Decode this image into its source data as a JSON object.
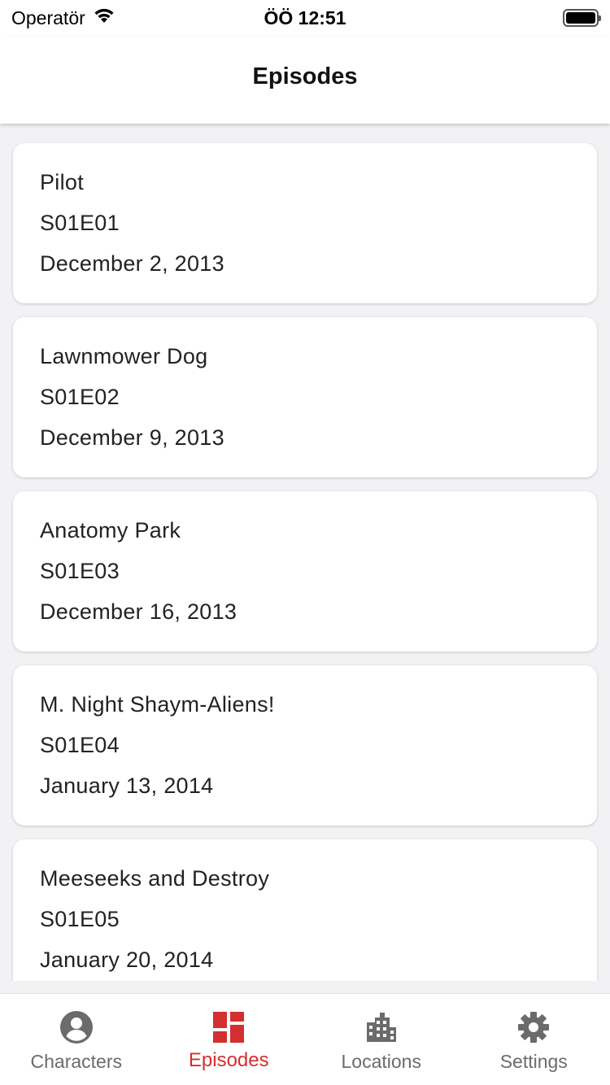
{
  "status_bar": {
    "carrier": "Operatör",
    "time": "ÖÖ 12:51"
  },
  "app_bar": {
    "title": "Episodes"
  },
  "episodes": [
    {
      "name": "Pilot",
      "code": "S01E01",
      "air_date": "December 2, 2013"
    },
    {
      "name": "Lawnmower Dog",
      "code": "S01E02",
      "air_date": "December 9, 2013"
    },
    {
      "name": "Anatomy Park",
      "code": "S01E03",
      "air_date": "December 16, 2013"
    },
    {
      "name": "M. Night Shaym-Aliens!",
      "code": "S01E04",
      "air_date": "January 13, 2014"
    },
    {
      "name": "Meeseeks and Destroy",
      "code": "S01E05",
      "air_date": "January 20, 2014"
    }
  ],
  "bottom_nav": {
    "items": [
      {
        "label": "Characters",
        "icon": "account-circle-icon",
        "active": false
      },
      {
        "label": "Episodes",
        "icon": "dashboard-icon",
        "active": true
      },
      {
        "label": "Locations",
        "icon": "city-icon",
        "active": false
      },
      {
        "label": "Settings",
        "icon": "gear-icon",
        "active": false
      }
    ],
    "active_color": "#d32f2f",
    "inactive_color": "#6b6b6b"
  }
}
